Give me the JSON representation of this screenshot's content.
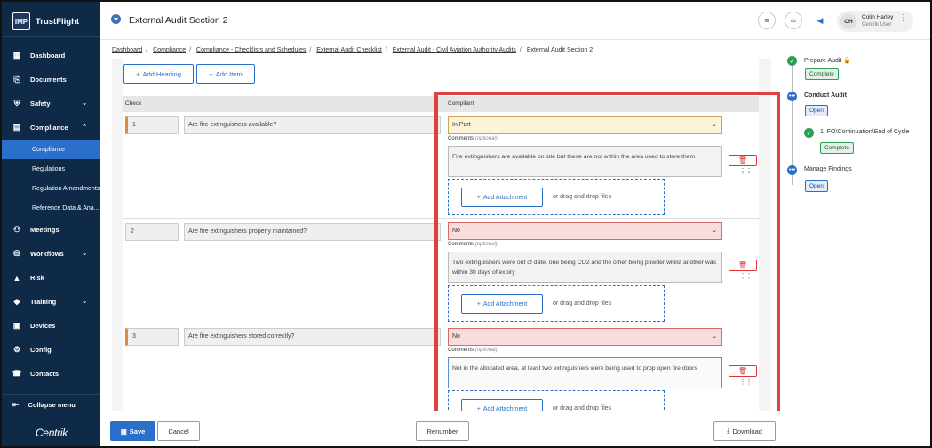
{
  "app": {
    "brand": "TrustFlight",
    "brand_logo": "IMP",
    "footer_brand": "Centrik"
  },
  "sidebar": {
    "items": [
      {
        "label": "Dashboard",
        "icon": "dashboard-icon"
      },
      {
        "label": "Documents",
        "icon": "paperclip-icon"
      },
      {
        "label": "Safety",
        "icon": "shield-icon",
        "expandable": true
      },
      {
        "label": "Compliance",
        "icon": "compliance-icon",
        "expandable": true,
        "expanded": true
      },
      {
        "label": "Meetings",
        "icon": "meetings-icon"
      },
      {
        "label": "Workflows",
        "icon": "workflows-icon",
        "expandable": true
      },
      {
        "label": "Risk",
        "icon": "risk-icon"
      },
      {
        "label": "Training",
        "icon": "training-icon",
        "expandable": true
      },
      {
        "label": "Devices",
        "icon": "devices-icon"
      },
      {
        "label": "Config",
        "icon": "config-icon"
      },
      {
        "label": "Contacts",
        "icon": "contacts-icon"
      }
    ],
    "compliance_sub": [
      "Compliance",
      "Regulations",
      "Regulation Amendments",
      "Reference Data & Ana..."
    ],
    "collapse_label": "Collapse menu"
  },
  "header": {
    "title": "External Audit Section 2",
    "user_initials": "CH",
    "user_name": "Colin Harley",
    "user_role": "Centrik User"
  },
  "breadcrumb": {
    "links": [
      "Dashboard",
      "Compliance",
      "Compliance - Checklists and Schedules",
      "External Audit Checklist",
      "External Audit - Civil Aviation Authority Audits"
    ],
    "current": "External Audit Section 2"
  },
  "toolbar": {
    "add_heading": "Add Heading",
    "add_item": "Add Item"
  },
  "table": {
    "col_check": "Check",
    "col_compliant": "Compliant"
  },
  "rows": [
    {
      "num": "1",
      "question": "Are fire extinguishers available?",
      "compliant": "In Part",
      "comment": "Fire extinguishers are available on site but these are not within the area used to store them"
    },
    {
      "num": "2",
      "question": "Are fire extinguishers properly maintained?",
      "compliant": "No",
      "comment": "Two extinguishers were out of date, one being CO2 and the other being powder whilst another was within 30 days of expiry"
    },
    {
      "num": "3",
      "question": "Are fire extinguishers stored correctly?",
      "compliant": "No",
      "comment": "Not in the allocated area, at least two extinguishers were being used to prop open fire doors"
    }
  ],
  "labels": {
    "comments": "Comments",
    "optional": "(optional)",
    "add_attachment": "Add Attachment",
    "drag_drop": "or drag and drop files"
  },
  "footer": {
    "save": "Save",
    "cancel": "Cancel",
    "renumber": "Renumber",
    "download": "Download"
  },
  "timeline": [
    {
      "label": "Prepare Audit",
      "status": "Complete",
      "locked": true
    },
    {
      "label": "Conduct Audit",
      "status": "Open"
    },
    {
      "label": "1. FO\\Continuation\\End of Cycle",
      "status": "Complete"
    },
    {
      "label": "Manage Findings",
      "status": "Open"
    }
  ]
}
